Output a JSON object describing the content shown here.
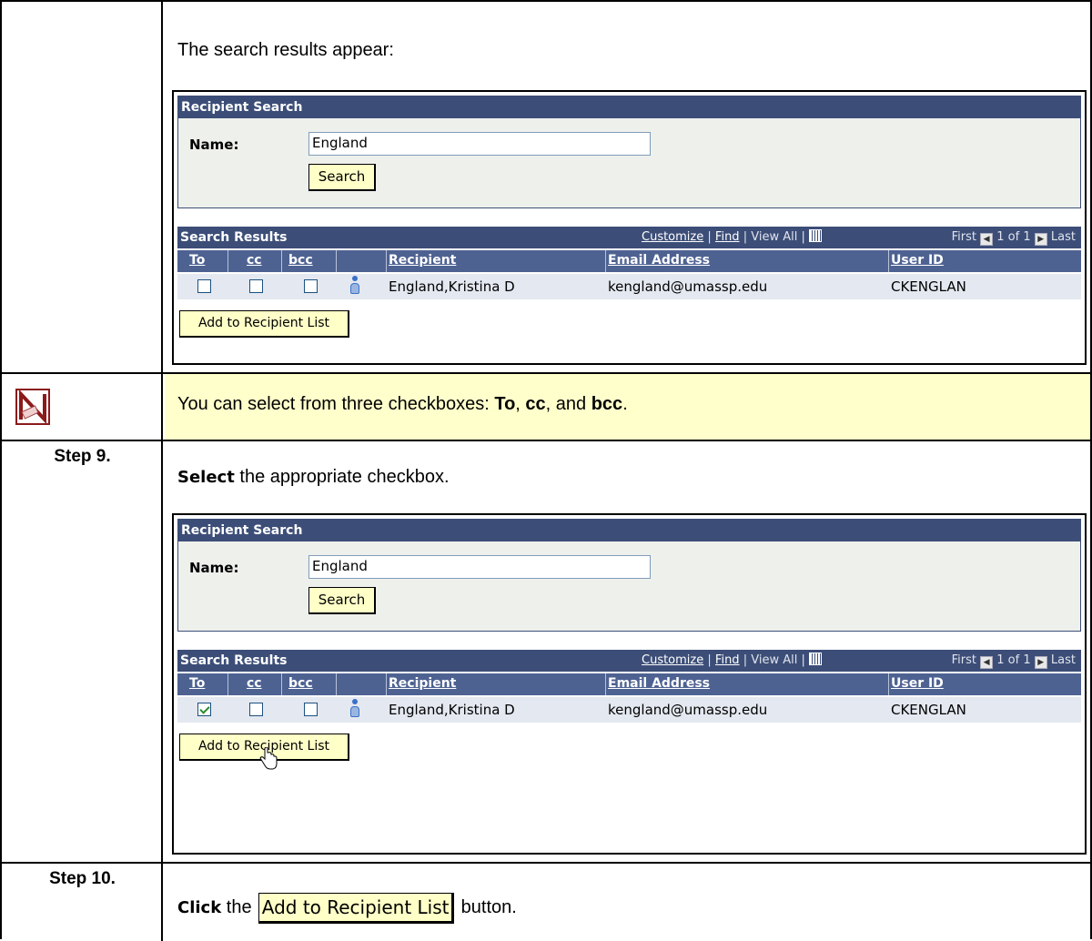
{
  "intro_text": "The search results appear:",
  "note": {
    "prefix": "You can select from three checkboxes: ",
    "to": "To",
    "comma1": ", ",
    "cc": "cc",
    "and": ", and ",
    "bcc": "bcc",
    "suffix": "."
  },
  "step9": {
    "label": "Step 9.",
    "action": "Select",
    "text": " the appropriate checkbox."
  },
  "step10": {
    "label": "Step 10.",
    "action": "Click",
    "text_before": " the ",
    "button_label": "Add to Recipient List",
    "text_after": " button."
  },
  "screens": [
    {
      "search_header": "Recipient Search",
      "name_label": "Name:",
      "name_value": "England",
      "search_button": "Search",
      "results_header": "Search Results",
      "customize": "Customize",
      "find": "Find",
      "view_all": "View All",
      "sep": "|",
      "first": "First",
      "page_info": "1 of 1",
      "last": "Last",
      "col_to": "To",
      "col_cc": "cc",
      "col_bcc": "bcc",
      "col_recipient": "Recipient",
      "col_email": "Email Address",
      "col_userid": "User ID",
      "row": {
        "recipient": "England,Kristina D",
        "email": "kengland@umassp.edu",
        "userid": "CKENGLAN",
        "to_checked": false
      },
      "add_button": "Add to Recipient List"
    },
    {
      "search_header": "Recipient Search",
      "name_label": "Name:",
      "name_value": "England",
      "search_button": "Search",
      "results_header": "Search Results",
      "customize": "Customize",
      "find": "Find",
      "view_all": "View All",
      "sep": "|",
      "first": "First",
      "page_info": "1 of 1",
      "last": "Last",
      "col_to": "To",
      "col_cc": "cc",
      "col_bcc": "bcc",
      "col_recipient": "Recipient",
      "col_email": "Email Address",
      "col_userid": "User ID",
      "row": {
        "recipient": "England,Kristina D",
        "email": "kengland@umassp.edu",
        "userid": "CKENGLAN",
        "to_checked": true
      },
      "add_button": "Add to Recipient List"
    }
  ]
}
